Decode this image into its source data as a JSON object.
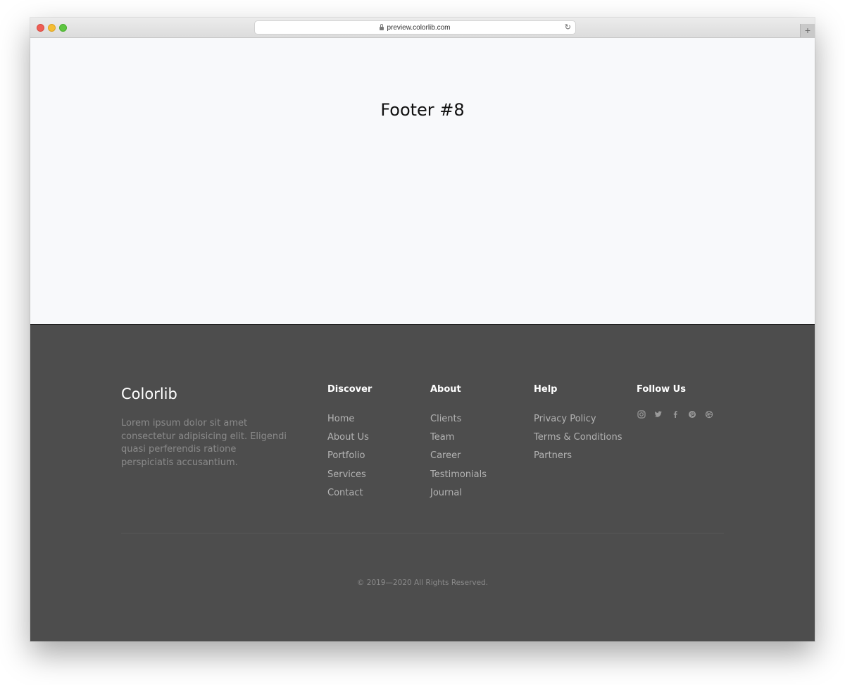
{
  "browser": {
    "url": "preview.colorlib.com",
    "newtab_label": "+"
  },
  "hero": {
    "title": "Footer #8"
  },
  "footer": {
    "brand": "Colorlib",
    "description": "Lorem ipsum dolor sit amet consectetur adipisicing elit. Eligendi quasi perferendis ratione perspiciatis accusantium.",
    "columns": [
      {
        "heading": "Discover",
        "links": [
          "Home",
          "About Us",
          "Portfolio",
          "Services",
          "Contact"
        ]
      },
      {
        "heading": "About",
        "links": [
          "Clients",
          "Team",
          "Career",
          "Testimonials",
          "Journal"
        ]
      },
      {
        "heading": "Help",
        "links": [
          "Privacy Policy",
          "Terms & Conditions",
          "Partners"
        ]
      }
    ],
    "follow": {
      "heading": "Follow Us",
      "icons": [
        "instagram-icon",
        "twitter-icon",
        "facebook-icon",
        "pinterest-icon",
        "dribbble-icon"
      ]
    },
    "copyright": "© 2019—2020 All Rights Reserved."
  },
  "colors": {
    "footer_bg": "#4d4d4d",
    "hero_bg": "#f8f9fb",
    "link": "#b3b3b3",
    "muted": "#8a8a8a",
    "heading": "#ffffff"
  }
}
